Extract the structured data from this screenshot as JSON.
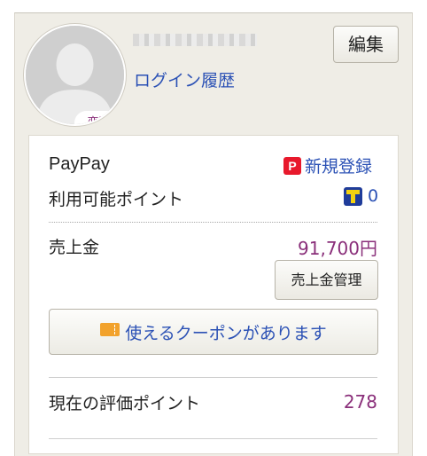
{
  "profile": {
    "avatar_change_label": "変更",
    "login_history_label": "ログイン履歴",
    "edit_button_label": "編集"
  },
  "paypay": {
    "label": "PayPay",
    "register_label": "新規登録",
    "register_icon": "paypay-p-icon"
  },
  "points": {
    "label": "利用可能ポイント",
    "value": "0",
    "icon": "t-point-icon"
  },
  "sales": {
    "label": "売上金",
    "amount": "91,700円",
    "manage_button_label": "売上金管理"
  },
  "coupon": {
    "label": "使えるクーポンがあります",
    "icon": "ticket-icon"
  },
  "evaluation": {
    "label": "現在の評価ポイント",
    "value": "278"
  },
  "colors": {
    "link": "#2b51b5",
    "amount": "#8a2f7a",
    "panel_bg": "#efede6",
    "paypay_red": "#e8192c",
    "tpoint_blue": "#1f3c9a",
    "coupon_orange": "#f2a22c"
  }
}
